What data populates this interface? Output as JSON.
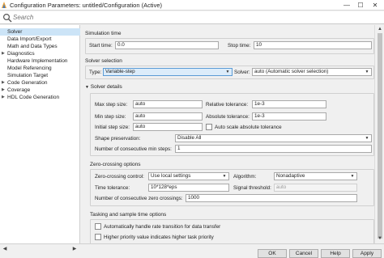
{
  "window": {
    "title": "Configuration Parameters: untitled/Configuration (Active)",
    "minimize_glyph": "—",
    "maximize_glyph": "☐",
    "close_glyph": "✕"
  },
  "search": {
    "placeholder": "Search"
  },
  "sidebar": {
    "items": [
      {
        "label": "Solver",
        "selected": true
      },
      {
        "label": "Data Import/Export"
      },
      {
        "label": "Math and Data Types"
      },
      {
        "label": "Diagnostics",
        "expandable": true
      },
      {
        "label": "Hardware Implementation"
      },
      {
        "label": "Model Referencing"
      },
      {
        "label": "Simulation Target"
      },
      {
        "label": "Code Generation",
        "expandable": true
      },
      {
        "label": "Coverage",
        "expandable": true
      },
      {
        "label": "HDL Code Generation",
        "expandable": true
      }
    ]
  },
  "simulation_time": {
    "title": "Simulation time",
    "start_label": "Start time:",
    "start_value": "0.0",
    "stop_label": "Stop time:",
    "stop_value": "10"
  },
  "solver_selection": {
    "title": "Solver selection",
    "type_label": "Type:",
    "type_value": "Variable-step",
    "solver_label": "Solver:",
    "solver_value": "auto (Automatic solver selection)"
  },
  "solver_details": {
    "title": "Solver details",
    "max_step_label": "Max step size:",
    "max_step_value": "auto",
    "rel_tol_label": "Relative tolerance:",
    "rel_tol_value": "1e-3",
    "min_step_label": "Min step size:",
    "min_step_value": "auto",
    "abs_tol_label": "Absolute tolerance:",
    "abs_tol_value": "1e-3",
    "initial_step_label": "Initial step size:",
    "initial_step_value": "auto",
    "auto_scale_label": "Auto scale absolute tolerance",
    "shape_label": "Shape preservation:",
    "shape_value": "Disable All",
    "consec_min_label": "Number of consecutive min steps:",
    "consec_min_value": "1"
  },
  "zero_crossing": {
    "title": "Zero-crossing options",
    "control_label": "Zero-crossing control:",
    "control_value": "Use local settings",
    "algorithm_label": "Algorithm:",
    "algorithm_value": "Nonadaptive",
    "time_tol_label": "Time tolerance:",
    "time_tol_value": "10*128*eps",
    "signal_threshold_label": "Signal threshold:",
    "signal_threshold_value": "auto",
    "consec_zc_label": "Number of consecutive zero crossings:",
    "consec_zc_value": "1000"
  },
  "tasking": {
    "title": "Tasking and sample time options",
    "auto_rate_label": "Automatically handle rate transition for data transfer",
    "higher_priority_label": "Higher priority value indicates higher task priority"
  },
  "buttons": {
    "ok": "OK",
    "cancel": "Cancel",
    "help": "Help",
    "apply": "Apply"
  },
  "colors": {
    "selection": "#cce4f7",
    "highlight_border": "#5b9bd5"
  }
}
